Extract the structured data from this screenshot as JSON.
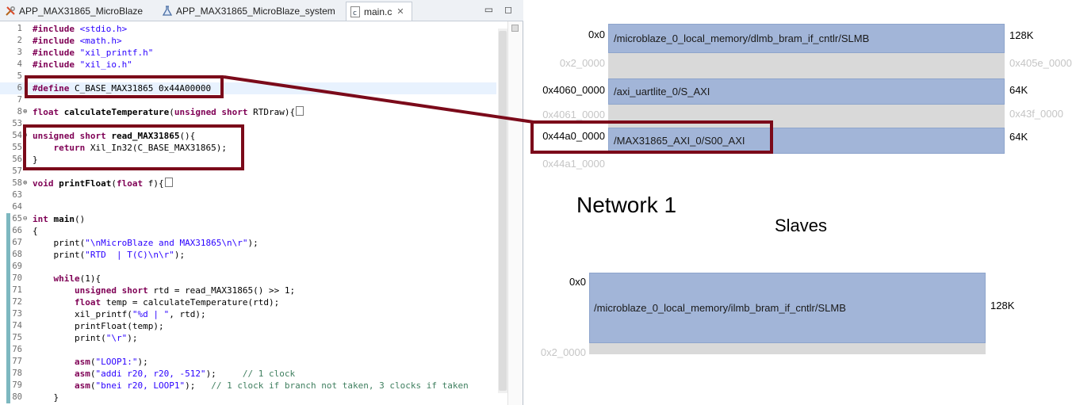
{
  "editor": {
    "tabs": [
      {
        "label": "APP_MAX31865_MicroBlaze",
        "icon": "tools-icon"
      },
      {
        "label": "APP_MAX31865_MicroBlaze_system",
        "icon": "flask-icon"
      },
      {
        "label": "main.c",
        "icon": "c-file-icon",
        "close": "✕"
      }
    ],
    "minimize": "▭",
    "maximize": "◻"
  },
  "code_lines": [
    {
      "n": "1",
      "segs": [
        [
          "pp",
          "#include "
        ],
        [
          "str",
          "<stdio.h>"
        ]
      ]
    },
    {
      "n": "2",
      "segs": [
        [
          "pp",
          "#include "
        ],
        [
          "str",
          "<math.h>"
        ]
      ]
    },
    {
      "n": "3",
      "segs": [
        [
          "pp",
          "#include "
        ],
        [
          "str",
          "\"xil_printf.h\""
        ]
      ]
    },
    {
      "n": "4",
      "segs": [
        [
          "pp",
          "#include "
        ],
        [
          "str",
          "\"xil_io.h\""
        ]
      ]
    },
    {
      "n": "5",
      "segs": []
    },
    {
      "n": "6",
      "segs": [
        [
          "pp",
          "#define "
        ],
        [
          "",
          "C_BASE_MAX31865 0x44A00000"
        ]
      ],
      "hl": true
    },
    {
      "n": "7",
      "segs": []
    },
    {
      "n": "8",
      "fold": "⊕",
      "segs": [
        [
          "kw",
          "float "
        ],
        [
          "fn",
          "calculateTemperature"
        ],
        [
          "",
          "("
        ],
        [
          "kw",
          "unsigned short "
        ],
        [
          "",
          "RTDraw){"
        ],
        [
          "box",
          ""
        ]
      ]
    },
    {
      "n": "53",
      "segs": []
    },
    {
      "n": "54",
      "fold": "⊖",
      "segs": [
        [
          "kw",
          "unsigned short "
        ],
        [
          "fn",
          "read_MAX31865"
        ],
        [
          "",
          "(){"
        ]
      ]
    },
    {
      "n": "55",
      "segs": [
        [
          "",
          "    "
        ],
        [
          "kw",
          "return "
        ],
        [
          "",
          "Xil_In32(C_BASE_MAX31865);"
        ]
      ]
    },
    {
      "n": "56",
      "segs": [
        [
          "",
          "}"
        ]
      ]
    },
    {
      "n": "57",
      "segs": []
    },
    {
      "n": "58",
      "fold": "⊕",
      "segs": [
        [
          "kw",
          "void "
        ],
        [
          "fn",
          "printFloat"
        ],
        [
          "",
          "("
        ],
        [
          "kw",
          "float "
        ],
        [
          "",
          "f){"
        ],
        [
          "box",
          ""
        ]
      ]
    },
    {
      "n": "63",
      "segs": []
    },
    {
      "n": "64",
      "segs": []
    },
    {
      "n": "65",
      "fold": "⊖",
      "segs": [
        [
          "kw",
          "int "
        ],
        [
          "fn",
          "main"
        ],
        [
          "",
          "()"
        ]
      ]
    },
    {
      "n": "66",
      "segs": [
        [
          "",
          "{"
        ]
      ]
    },
    {
      "n": "67",
      "segs": [
        [
          "",
          "    print("
        ],
        [
          "str",
          "\"\\nMicroBlaze and MAX31865\\n\\r\""
        ],
        [
          "",
          ");"
        ]
      ]
    },
    {
      "n": "68",
      "segs": [
        [
          "",
          "    print("
        ],
        [
          "str",
          "\"RTD  | T(C)\\n\\r\""
        ],
        [
          "",
          ");"
        ]
      ]
    },
    {
      "n": "69",
      "segs": []
    },
    {
      "n": "70",
      "segs": [
        [
          "",
          "    "
        ],
        [
          "kw",
          "while"
        ],
        [
          "",
          "(1){"
        ]
      ]
    },
    {
      "n": "71",
      "segs": [
        [
          "",
          "        "
        ],
        [
          "kw",
          "unsigned short "
        ],
        [
          "",
          "rtd = read_MAX31865() >> 1;"
        ]
      ]
    },
    {
      "n": "72",
      "segs": [
        [
          "",
          "        "
        ],
        [
          "kw",
          "float "
        ],
        [
          "",
          "temp = calculateTemperature(rtd);"
        ]
      ]
    },
    {
      "n": "73",
      "segs": [
        [
          "",
          "        xil_printf("
        ],
        [
          "str",
          "\"%d | \""
        ],
        [
          "",
          ", rtd);"
        ]
      ]
    },
    {
      "n": "74",
      "segs": [
        [
          "",
          "        printFloat(temp);"
        ]
      ]
    },
    {
      "n": "75",
      "segs": [
        [
          "",
          "        print("
        ],
        [
          "str",
          "\"\\r\""
        ],
        [
          "",
          ");"
        ]
      ]
    },
    {
      "n": "76",
      "segs": []
    },
    {
      "n": "77",
      "segs": [
        [
          "",
          "        "
        ],
        [
          "kw",
          "asm"
        ],
        [
          "",
          "("
        ],
        [
          "str",
          "\"LOOP1:\""
        ],
        [
          "",
          ");"
        ]
      ]
    },
    {
      "n": "78",
      "segs": [
        [
          "",
          "        "
        ],
        [
          "kw",
          "asm"
        ],
        [
          "",
          "("
        ],
        [
          "str",
          "\"addi r20, r20, -512\""
        ],
        [
          "",
          ");     "
        ],
        [
          "cmt",
          "// 1 clock"
        ]
      ]
    },
    {
      "n": "79",
      "segs": [
        [
          "",
          "        "
        ],
        [
          "kw",
          "asm"
        ],
        [
          "",
          "("
        ],
        [
          "str",
          "\"bnei r20, LOOP1\""
        ],
        [
          "",
          ");   "
        ],
        [
          "cmt",
          "// 1 clock if branch not taken, 3 clocks if taken"
        ]
      ]
    },
    {
      "n": "80",
      "segs": [
        [
          "",
          "    }"
        ]
      ]
    }
  ],
  "address_map": {
    "network1": [
      {
        "addr": "0x0",
        "label": "/microblaze_0_local_memory/dlmb_bram_if_cntlr/SLMB",
        "size": "128K",
        "kind": "used"
      },
      {
        "addr": "0x2_0000",
        "label": "",
        "size": "0x405e_0000",
        "kind": "gap"
      },
      {
        "addr": "0x4060_0000",
        "label": "/axi_uartlite_0/S_AXI",
        "size": "64K",
        "kind": "used"
      },
      {
        "addr": "0x4061_0000",
        "label": "",
        "size": "0x43f_0000",
        "kind": "gap"
      },
      {
        "addr": "0x44a0_0000",
        "label": "/MAX31865_AXI_0/S00_AXI",
        "size": "64K",
        "kind": "used"
      },
      {
        "addr": "0x44a1_0000",
        "label": "",
        "size": "",
        "kind": "end"
      }
    ],
    "network_title": "Network 1",
    "slaves_title": "Slaves",
    "slaves": [
      {
        "addr": "0x0",
        "label": "/microblaze_0_local_memory/ilmb_bram_if_cntlr/SLMB",
        "size": "128K",
        "kind": "used"
      },
      {
        "addr": "0x2_0000",
        "label": "",
        "size": "",
        "kind": "end"
      }
    ]
  },
  "colors": {
    "used": "#a2b5d8",
    "gap": "#d9d9d9",
    "annotation": "#7b0a1a"
  }
}
